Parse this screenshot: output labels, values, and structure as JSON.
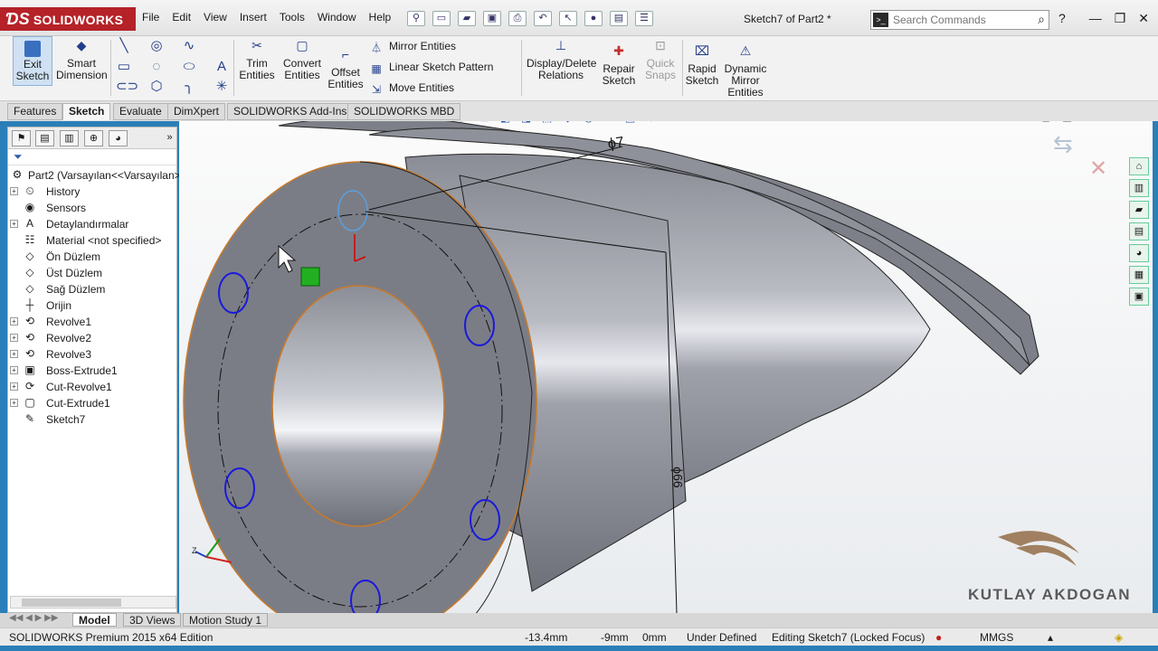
{
  "app": {
    "logo": "SOLIDWORKS",
    "document_title": "Sketch7 of Part2 *"
  },
  "menu": [
    "File",
    "Edit",
    "View",
    "Insert",
    "Tools",
    "Window",
    "Help"
  ],
  "search": {
    "placeholder": "Search Commands"
  },
  "ribbon": {
    "exit_sketch": "Exit\nSketch",
    "smart_dimension": "Smart\nDimension",
    "trim_entities": "Trim\nEntities",
    "convert_entities": "Convert\nEntities",
    "offset_entities": "Offset\nEntities",
    "mirror_entities": "Mirror Entities",
    "linear_sketch_pattern": "Linear Sketch Pattern",
    "move_entities": "Move Entities",
    "display_delete_relations": "Display/Delete\nRelations",
    "repair_sketch": "Repair\nSketch",
    "quick_snaps": "Quick\nSnaps",
    "rapid_sketch": "Rapid\nSketch",
    "dynamic_mirror": "Dynamic\nMirror\nEntities"
  },
  "tabs": [
    "Features",
    "Sketch",
    "Evaluate",
    "DimXpert",
    "SOLIDWORKS Add-Ins",
    "SOLIDWORKS MBD"
  ],
  "active_tab": "Sketch",
  "tree": {
    "root": "Part2  (Varsayılan<<Varsayılan>",
    "items": [
      {
        "label": "History",
        "icon": "history-icon",
        "expandable": true
      },
      {
        "label": "Sensors",
        "icon": "sensor-icon",
        "expandable": false
      },
      {
        "label": "Detaylandırmalar",
        "icon": "annotation-icon",
        "expandable": true
      },
      {
        "label": "Material <not specified>",
        "icon": "material-icon",
        "expandable": false
      },
      {
        "label": "Ön Düzlem",
        "icon": "plane-icon",
        "expandable": false
      },
      {
        "label": "Üst Düzlem",
        "icon": "plane-icon",
        "expandable": false
      },
      {
        "label": "Sağ Düzlem",
        "icon": "plane-icon",
        "expandable": false
      },
      {
        "label": "Orijin",
        "icon": "origin-icon",
        "expandable": false
      },
      {
        "label": "Revolve1",
        "icon": "revolve-icon",
        "expandable": true
      },
      {
        "label": "Revolve2",
        "icon": "revolve-icon",
        "expandable": true
      },
      {
        "label": "Revolve3",
        "icon": "revolve-icon",
        "expandable": true
      },
      {
        "label": "Boss-Extrude1",
        "icon": "extrude-icon",
        "expandable": true
      },
      {
        "label": "Cut-Revolve1",
        "icon": "cut-revolve-icon",
        "expandable": true
      },
      {
        "label": "Cut-Extrude1",
        "icon": "cut-extrude-icon",
        "expandable": true
      },
      {
        "label": "Sketch7",
        "icon": "sketch-icon",
        "expandable": false
      }
    ]
  },
  "viewport": {
    "dimension_top": "ϕ7",
    "dimension_side": "ϕ66",
    "watermark": "KUTLAY AKDOGAN"
  },
  "bottom_tabs": [
    "Model",
    "3D Views",
    "Motion Study 1"
  ],
  "status": {
    "edition": "SOLIDWORKS Premium 2015 x64 Edition",
    "x": "-13.4mm",
    "y": "-9mm",
    "z": "0mm",
    "state": "Under Defined",
    "editing": "Editing Sketch7 (Locked Focus)",
    "units": "MMGS"
  },
  "colors": {
    "brand_red": "#b52228",
    "sketch_blue": "#1a1adc",
    "selection_orange": "#c87a2a",
    "part_gray": "#7b7d86"
  }
}
